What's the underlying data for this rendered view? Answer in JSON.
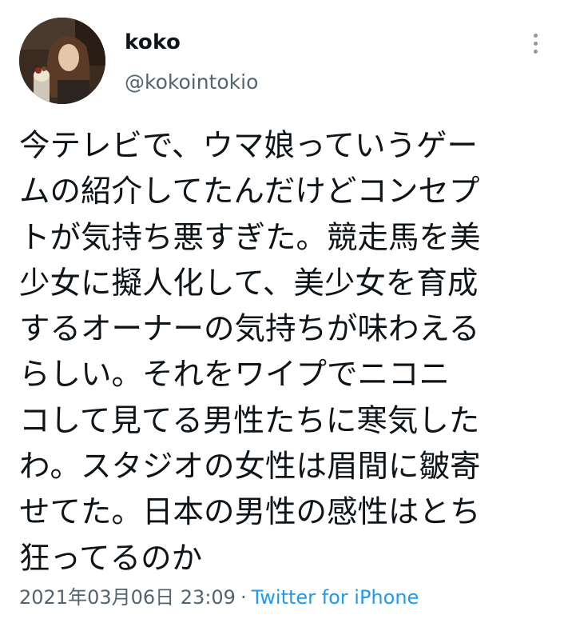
{
  "user": {
    "display_name": "koko",
    "handle": "@kokointokio"
  },
  "tweet": {
    "text": "今テレビで、ウマ娘っていうゲー\nムの紹介してたんだけどコンセプ\nトが気持ち悪すぎた。競走馬を美\n少女に擬人化して、美少女を育成\nするオーナーの気持ちが味わえる\nらしい。それをワイプでニコニ\nコして見てる男性たちに寒気した\nわ。スタジオの女性は眉間に皺寄\nせてた。日本の男性の感性はとち\n狂ってるのか",
    "date": "2021年03月06日 23:09",
    "separator": "·",
    "source": "Twitter for iPhone"
  },
  "icons": {
    "more": "more-vertical-icon"
  },
  "colors": {
    "text": "#0f1419",
    "secondary": "#536471",
    "link": "#1d9bf0"
  }
}
